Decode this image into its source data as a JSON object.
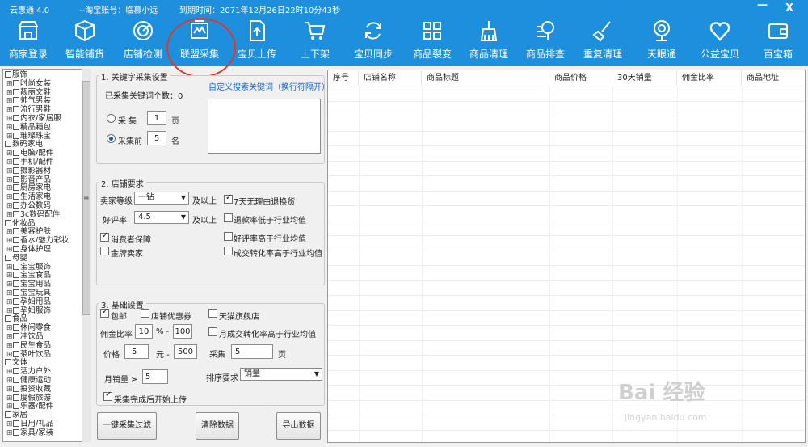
{
  "titlebar": {
    "app_name": "云惠通 4.0",
    "account": "--淘宝账号：临慕小远",
    "expire": "到期时间：2071年12月26日22时10分43秒",
    "minimize": "—",
    "close": "X"
  },
  "toolbar": [
    {
      "label": "商家登录",
      "icon": "store-icon"
    },
    {
      "label": "智能铺货",
      "icon": "box-icon"
    },
    {
      "label": "店铺检测",
      "icon": "radar-icon"
    },
    {
      "label": "联盟采集",
      "icon": "collect-icon"
    },
    {
      "label": "宝贝上传",
      "icon": "upload-doc-icon"
    },
    {
      "label": "上下架",
      "icon": "cart-icon"
    },
    {
      "label": "宝贝同步",
      "icon": "sync-icon"
    },
    {
      "label": "商品裂变",
      "icon": "grid-icon"
    },
    {
      "label": "商品清理",
      "icon": "broom-icon"
    },
    {
      "label": "商品排查",
      "icon": "magnifier-icon"
    },
    {
      "label": "重复清理",
      "icon": "brush-icon"
    },
    {
      "label": "天眼通",
      "icon": "camera-icon"
    },
    {
      "label": "公益宝贝",
      "icon": "heart-icon"
    },
    {
      "label": "百宝箱",
      "icon": "wallet-icon"
    }
  ],
  "tree": [
    {
      "label": "服饰",
      "level": 0
    },
    {
      "label": "时尚女装",
      "level": 1
    },
    {
      "label": "靓丽文鞋",
      "level": 1
    },
    {
      "label": "帅气男装",
      "level": 1
    },
    {
      "label": "流行男鞋",
      "level": 1
    },
    {
      "label": "内衣/家居服",
      "level": 1
    },
    {
      "label": "精品箱包",
      "level": 1
    },
    {
      "label": "璀璨珠宝",
      "level": 1
    },
    {
      "label": "数码家电",
      "level": 0
    },
    {
      "label": "电脑/配件",
      "level": 1
    },
    {
      "label": "手机/配件",
      "level": 1
    },
    {
      "label": "摄影器材",
      "level": 1
    },
    {
      "label": "影音产品",
      "level": 1
    },
    {
      "label": "厨房家电",
      "level": 1
    },
    {
      "label": "生活家电",
      "level": 1
    },
    {
      "label": "办公数码",
      "level": 1
    },
    {
      "label": "3c数码配件",
      "level": 1
    },
    {
      "label": "化妆品",
      "level": 0
    },
    {
      "label": "美容护肤",
      "level": 1
    },
    {
      "label": "香水/魅力彩妆",
      "level": 1
    },
    {
      "label": "身体护理",
      "level": 1
    },
    {
      "label": "母婴",
      "level": 0
    },
    {
      "label": "宝宝服饰",
      "level": 1
    },
    {
      "label": "宝宝食品",
      "level": 1
    },
    {
      "label": "宝宝用品",
      "level": 1
    },
    {
      "label": "宝宝玩具",
      "level": 1
    },
    {
      "label": "孕妇用品",
      "level": 1
    },
    {
      "label": "孕妇服饰",
      "level": 1
    },
    {
      "label": "食品",
      "level": 0
    },
    {
      "label": "休闲零食",
      "level": 1
    },
    {
      "label": "冲饮品",
      "level": 1
    },
    {
      "label": "民生食品",
      "level": 1
    },
    {
      "label": "茶叶饮品",
      "level": 1
    },
    {
      "label": "文体",
      "level": 0
    },
    {
      "label": "活力户外",
      "level": 1
    },
    {
      "label": "健康运动",
      "level": 1
    },
    {
      "label": "投资收藏",
      "level": 1
    },
    {
      "label": "度假旅游",
      "level": 1
    },
    {
      "label": "乐器/配件",
      "level": 1
    },
    {
      "label": "家居",
      "level": 0
    },
    {
      "label": "日用/礼品",
      "level": 1
    },
    {
      "label": "家具/家装",
      "level": 1
    }
  ],
  "section1": {
    "title": "1. 关键字采集设置",
    "custom_link": "自定义搜索关键词（换行符隔开）",
    "count_label": "已采集关键词个数：0",
    "radio1_label": "采 集",
    "radio1_value": "1",
    "radio1_unit": "页",
    "radio2_label": "采集前",
    "radio2_value": "5",
    "radio2_unit": "名"
  },
  "section2": {
    "title": "2. 店铺要求",
    "seller_level_label": "卖家等级",
    "seller_level_value": "一钻",
    "seller_level_suffix": "及以上",
    "rating_label": "好评率",
    "rating_value": "4.5",
    "rating_suffix": "及以上",
    "cb_refund7": "7天无理由退换货",
    "cb_refund_rate": "退款率低于行业均值",
    "cb_consumer": "消费者保障",
    "cb_praise_rate": "好评率高于行业均值",
    "cb_gold": "金牌卖家",
    "cb_conv_rate": "成交转化率高于行业均值"
  },
  "section3": {
    "title": "3. 基础设置",
    "cb_free_ship": "包邮",
    "cb_coupon": "店铺优惠券",
    "cb_tmall": "天猫旗舰店",
    "commission_label": "佣金比率",
    "commission_from": "10",
    "commission_sep": "% -",
    "commission_to": "100",
    "cb_monthly_conv": "月成交转化率高于行业均值",
    "price_label": "价格",
    "price_from": "5",
    "price_sep": "元 -",
    "price_to": "500",
    "collect_label": "采集",
    "collect_value": "5",
    "collect_unit": "页",
    "monthly_sales_label": "月销量 ≥",
    "monthly_sales_value": "5",
    "sort_label": "排序要求",
    "sort_value": "销量",
    "cb_upload_after": "采集完成后开始上传"
  },
  "buttons": {
    "one_click": "一键采集过滤",
    "clear": "清除数据",
    "export": "导出数据"
  },
  "table": {
    "columns": [
      "序号",
      "店铺名称",
      "商品标题",
      "商品价格",
      "30天销量",
      "佣金比率",
      "商品地址"
    ]
  },
  "watermark": {
    "text": "Bai 经验",
    "url": "jingyan.baidu.com"
  },
  "colors": {
    "header_blue": "#1e8fdc",
    "link_blue": "#1c63c7",
    "annotation_red": "#e0362c"
  }
}
